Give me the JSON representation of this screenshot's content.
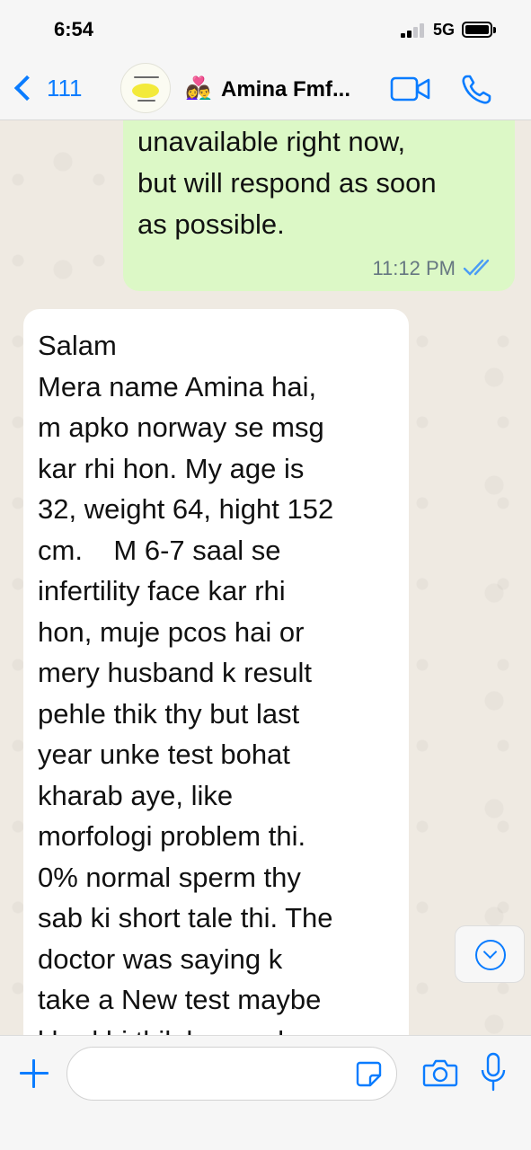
{
  "status_bar": {
    "time": "6:54",
    "network": "5G"
  },
  "header": {
    "back_count": "111",
    "contact_emoji": "👩‍❤️‍👨",
    "contact_name": "Amina Fmf...",
    "video_icon": "video-camera-icon",
    "call_icon": "phone-icon"
  },
  "messages": [
    {
      "direction": "outgoing",
      "text": "message. Im\nunavailable right now,\nbut will respond as soon\nas possible.",
      "time": "11:12 PM",
      "status": "read"
    },
    {
      "direction": "incoming",
      "text": "Salam\nMera name Amina hai,\nm apko norway se msg\nkar rhi hon. My age is\n32, weight 64, hight 152\ncm.    M 6-7 saal se\ninfertility face kar rhi\nhon, muje pcos hai or\nmery husband k result\npehle thik thy but last\nyear unke test bohat\nkharab aye, like\nmorfologi problem thi.\n0% normal sperm thy\nsab ki short tale thi. The\ndoctor was saying k\ntake a New test maybe\nkhud hi thik ho gya ho"
    }
  ],
  "composer": {
    "input_value": "",
    "input_placeholder": "",
    "icons": [
      "plus-icon",
      "sticker-icon",
      "camera-icon",
      "microphone-icon"
    ]
  },
  "colors": {
    "accent": "#0a7cff",
    "outgoing_bubble": "#dcf8c6",
    "incoming_bubble": "#ffffff",
    "chat_background": "#efeae2"
  }
}
